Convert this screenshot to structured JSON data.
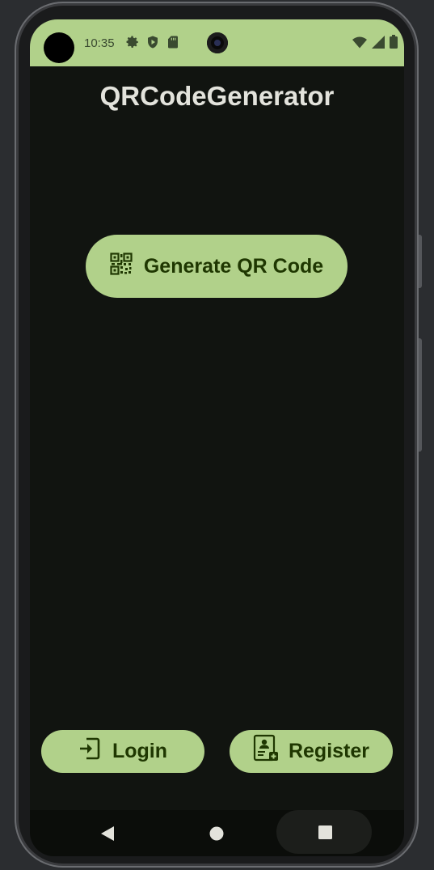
{
  "status_bar": {
    "time": "10:35",
    "left_icons": [
      "settings-icon",
      "shield-play-icon",
      "sd-card-icon"
    ],
    "right_icons": [
      "wifi-icon",
      "signal-icon",
      "battery-icon"
    ],
    "background_color": "#b1d18a"
  },
  "app": {
    "title": "QRCodeGenerator",
    "background_color": "#111410",
    "accent_color": "#b1d18a",
    "on_accent_color": "#1f3701"
  },
  "buttons": {
    "generate": {
      "label": "Generate QR Code",
      "icon": "qr-code-icon"
    },
    "login": {
      "label": "Login",
      "icon": "login-icon"
    },
    "register": {
      "label": "Register",
      "icon": "register-icon"
    }
  },
  "navigation": {
    "back": "back-icon",
    "home": "home-icon",
    "recents": "recents-icon"
  }
}
